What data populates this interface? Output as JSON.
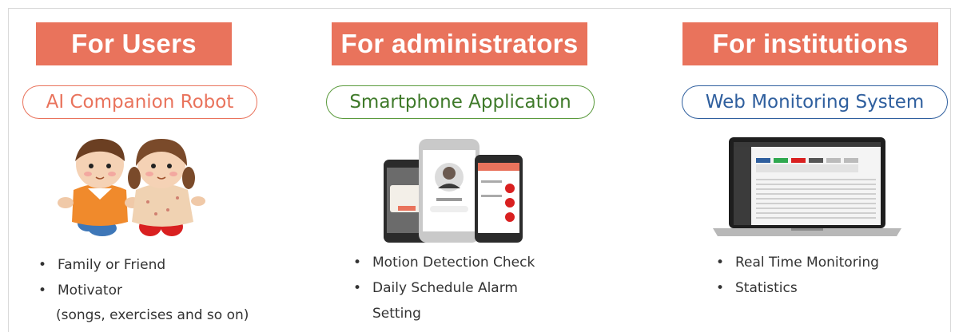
{
  "users": {
    "banner": "For Users",
    "pill": "AI Companion Robot",
    "bullets": [
      "Family or Friend",
      "Motivator"
    ],
    "note": "(songs, exercises and so on)"
  },
  "admins": {
    "banner": "For administrators",
    "pill": "Smartphone Application",
    "bullets": [
      "Motion Detection Check",
      "Daily Schedule Alarm"
    ],
    "bullet_cont": "Setting"
  },
  "institutions": {
    "banner": "For institutions",
    "pill": "Web Monitoring System",
    "bullets": [
      "Real Time Monitoring",
      "Statistics"
    ]
  },
  "colors": {
    "banner": "#e9735c",
    "pill_users": "#e9735c",
    "pill_admins": "#5a9a3c",
    "pill_institutions": "#2f5f9e"
  },
  "icons": [
    "robot-dolls-image",
    "smartphones-image",
    "laptop-image"
  ]
}
